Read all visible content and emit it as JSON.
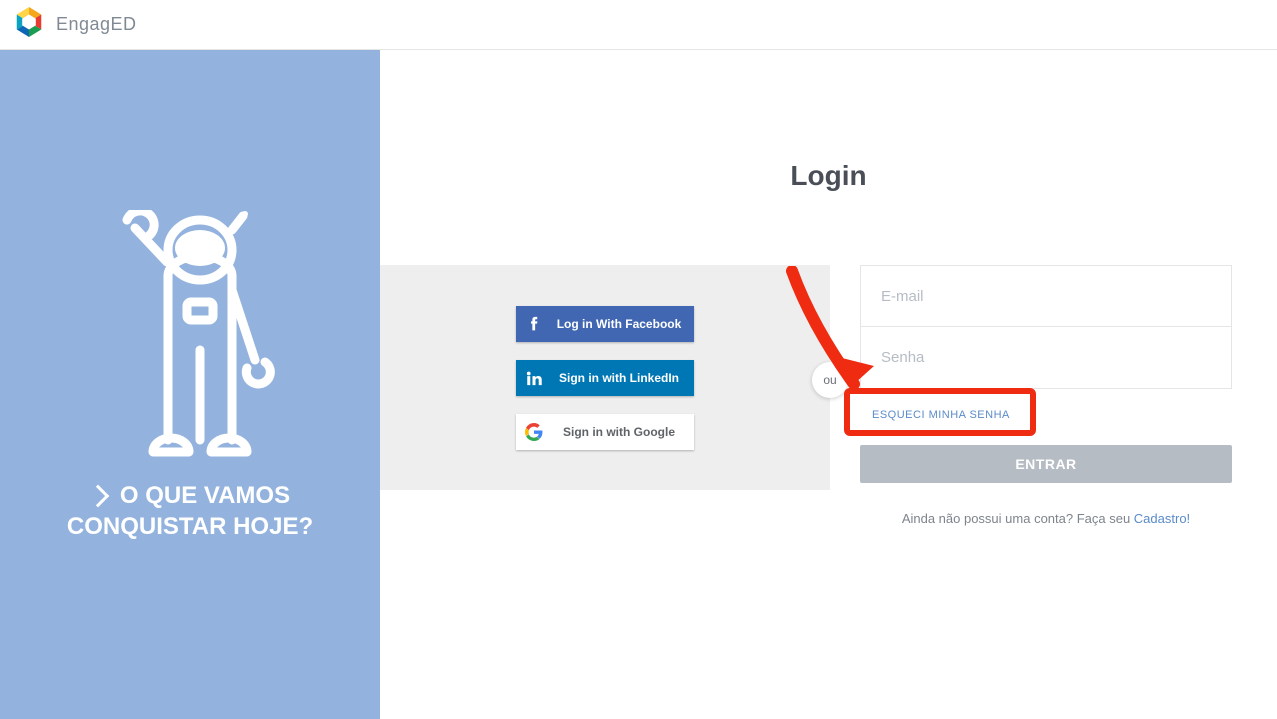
{
  "header": {
    "brand": "EngagED"
  },
  "sidebar": {
    "caption_line1": "O QUE VAMOS",
    "caption_line2": "CONQUISTAR HOJE?"
  },
  "login": {
    "title": "Login",
    "or_label": "ou",
    "social": {
      "facebook": "Log in With Facebook",
      "linkedin": "Sign in with LinkedIn",
      "google": "Sign in with Google"
    },
    "form": {
      "email_placeholder": "E-mail",
      "password_placeholder": "Senha",
      "forgot_label": "ESQUECI MINHA SENHA",
      "submit_label": "ENTRAR",
      "signup_prefix": "Ainda não possui uma conta? Faça seu ",
      "signup_link": "Cadastro!"
    }
  }
}
